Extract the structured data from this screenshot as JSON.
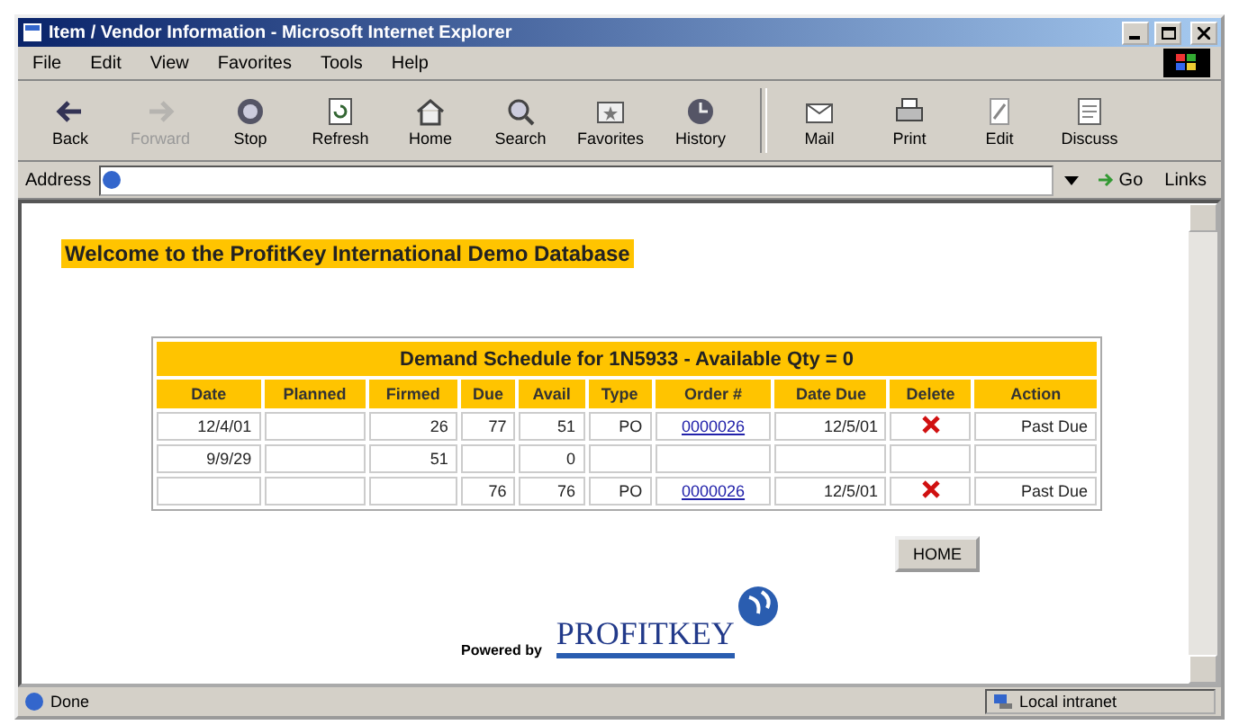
{
  "window": {
    "title": "Item / Vendor Information - Microsoft Internet Explorer"
  },
  "menu": [
    "File",
    "Edit",
    "View",
    "Favorites",
    "Tools",
    "Help"
  ],
  "toolbar": [
    {
      "label": "Back",
      "disabled": false
    },
    {
      "label": "Forward",
      "disabled": true
    },
    {
      "label": "Stop",
      "disabled": false
    },
    {
      "label": "Refresh",
      "disabled": false
    },
    {
      "label": "Home",
      "disabled": false
    },
    {
      "label": "Search",
      "disabled": false
    },
    {
      "label": "Favorites",
      "disabled": false
    },
    {
      "label": "History",
      "disabled": false
    },
    {
      "label": "Mail",
      "disabled": false
    },
    {
      "label": "Print",
      "disabled": false
    },
    {
      "label": "Edit",
      "disabled": false
    },
    {
      "label": "Discuss",
      "disabled": false
    }
  ],
  "address_bar": {
    "label": "Address",
    "go": "Go",
    "links": "Links"
  },
  "page": {
    "heading": "Welcome to the ProfitKey International Demo Database",
    "table": {
      "title": "Demand Schedule for 1N5933 - Available Qty = 0",
      "columns": [
        "Date",
        "Planned",
        "Firmed",
        "Due",
        "Avail",
        "Type",
        "Order #",
        "Date Due",
        "Delete",
        "Action"
      ],
      "rows": [
        {
          "date": "12/4/01",
          "firmed": "26",
          "due": "77",
          "avail": "51",
          "type": "PO",
          "order": "0000026",
          "date_due": "12/5/01",
          "deletable": true,
          "action": "Past Due"
        },
        {
          "date": "9/9/29",
          "firmed": "51",
          "avail": "0",
          "deletable": false
        },
        {
          "due": "76",
          "avail": "76",
          "type": "PO",
          "order": "0000026",
          "date_due": "12/5/01",
          "deletable": true,
          "action": "Past Due"
        }
      ]
    },
    "home_button": "HOME",
    "powered_by": "Powered by",
    "logo": "PROFITKEY"
  },
  "status_bar": {
    "text": "Done",
    "zone": "Local intranet"
  }
}
